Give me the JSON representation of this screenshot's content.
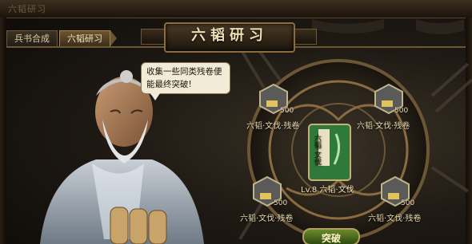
{
  "corner": {
    "text": "六韬研习"
  },
  "tabs": [
    {
      "label": "兵书合成",
      "active": false
    },
    {
      "label": "六韬研习",
      "active": true
    }
  ],
  "title": "六韬研习",
  "npc": {
    "speech": "收集一些同类残卷便能最终突破!"
  },
  "center": {
    "book_title": "六韬·文伐",
    "level_label": "Lv.8 六韬·文伐"
  },
  "slots": [
    {
      "position": "top-left",
      "count": "500",
      "label": "六韬·文伐·残卷"
    },
    {
      "position": "top-right",
      "count": "500",
      "label": "六韬·文伐·残卷"
    },
    {
      "position": "bottom-left",
      "count": "500",
      "label": "六韬·文伐·残卷"
    },
    {
      "position": "bottom-right",
      "count": "500",
      "label": "六韬·文伐·残卷"
    }
  ],
  "buttons": {
    "breakthrough": "突破"
  },
  "colors": {
    "gold": "#d8b86a",
    "book_green": "#2f7a3a",
    "parchment": "#f2ebd8"
  }
}
